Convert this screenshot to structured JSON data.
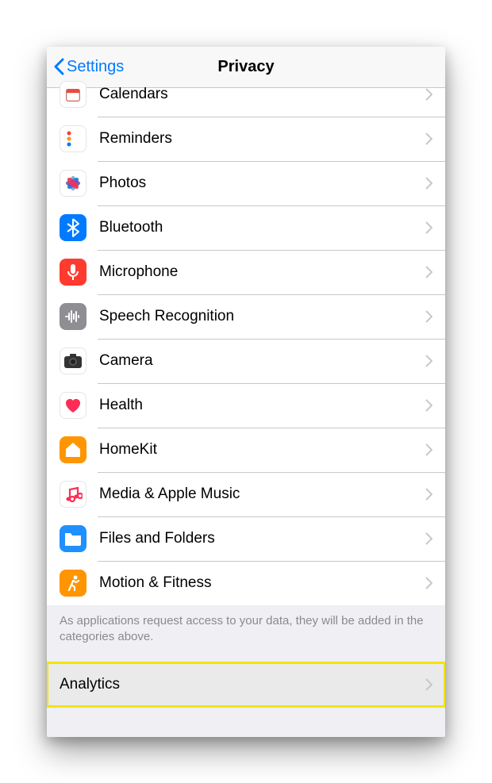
{
  "nav": {
    "back_label": "Settings",
    "title": "Privacy"
  },
  "rows": [
    {
      "id": "calendars",
      "label": "Calendars",
      "icon": "calendar-icon"
    },
    {
      "id": "reminders",
      "label": "Reminders",
      "icon": "reminders-icon"
    },
    {
      "id": "photos",
      "label": "Photos",
      "icon": "photos-icon"
    },
    {
      "id": "bluetooth",
      "label": "Bluetooth",
      "icon": "bluetooth-icon"
    },
    {
      "id": "microphone",
      "label": "Microphone",
      "icon": "microphone-icon"
    },
    {
      "id": "speech",
      "label": "Speech Recognition",
      "icon": "speech-icon"
    },
    {
      "id": "camera",
      "label": "Camera",
      "icon": "camera-icon"
    },
    {
      "id": "health",
      "label": "Health",
      "icon": "health-icon"
    },
    {
      "id": "homekit",
      "label": "HomeKit",
      "icon": "homekit-icon"
    },
    {
      "id": "media",
      "label": "Media & Apple Music",
      "icon": "media-icon"
    },
    {
      "id": "files",
      "label": "Files and Folders",
      "icon": "files-icon"
    },
    {
      "id": "motion",
      "label": "Motion & Fitness",
      "icon": "motion-icon"
    }
  ],
  "footer_note": "As applications request access to your data, they will be added in the categories above.",
  "group2": {
    "analytics_label": "Analytics"
  }
}
